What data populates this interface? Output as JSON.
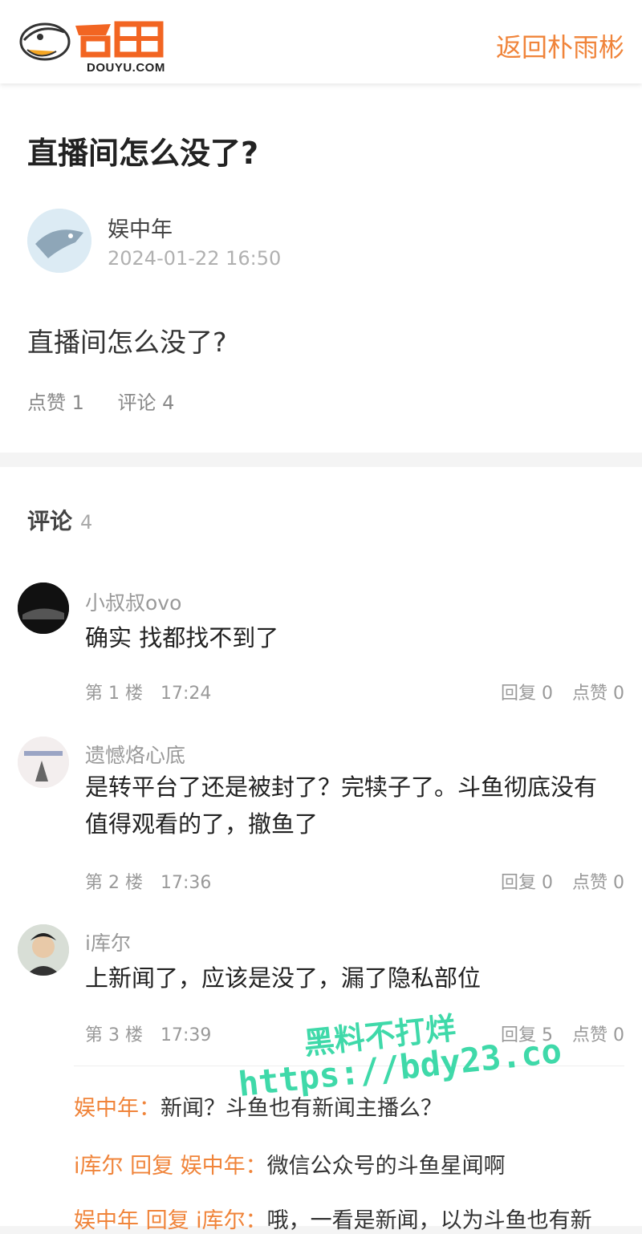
{
  "header": {
    "logo_text": "DOUYU.COM",
    "back_link": "返回朴雨彬"
  },
  "post": {
    "title": "直播间怎么没了?",
    "author": "娱中年",
    "time": "2024-01-22 16:50",
    "body": "直播间怎么没了?",
    "likes": "点赞 1",
    "comments": "评论 4"
  },
  "comments": {
    "heading": "评论",
    "count": "4",
    "items": [
      {
        "user": "小叔叔ovo",
        "text": "确实 找都找不到了",
        "floor": "第 1 楼",
        "time": "17:24",
        "reply": "回复 0",
        "like": "点赞 0"
      },
      {
        "user": "遗憾烙心底",
        "text": "是转平台了还是被封了？完犊子了。斗鱼彻底没有值得观看的了，撤鱼了",
        "floor": "第 2 楼",
        "time": "17:36",
        "reply": "回复 0",
        "like": "点赞 0"
      },
      {
        "user": "i库尔",
        "text": "上新闻了，应该是没了，漏了隐私部位",
        "floor": "第 3 楼",
        "time": "17:39",
        "reply": "回复 5",
        "like": "点赞 0"
      }
    ],
    "replies": [
      {
        "user": "娱中年：",
        "text": "新闻？斗鱼也有新闻主播么？"
      },
      {
        "user": "i库尔 回复 娱中年：",
        "text": "微信公众号的斗鱼星闻啊"
      },
      {
        "user": "娱中年 回复 i库尔：",
        "text": "哦，一看是新闻，以为斗鱼也有新"
      }
    ]
  },
  "watermark": {
    "line1": "黑料不打烊",
    "line2": "https://bdy23.co"
  },
  "colors": {
    "accent": "#f0843a",
    "watermark": "#3fd9a9"
  }
}
